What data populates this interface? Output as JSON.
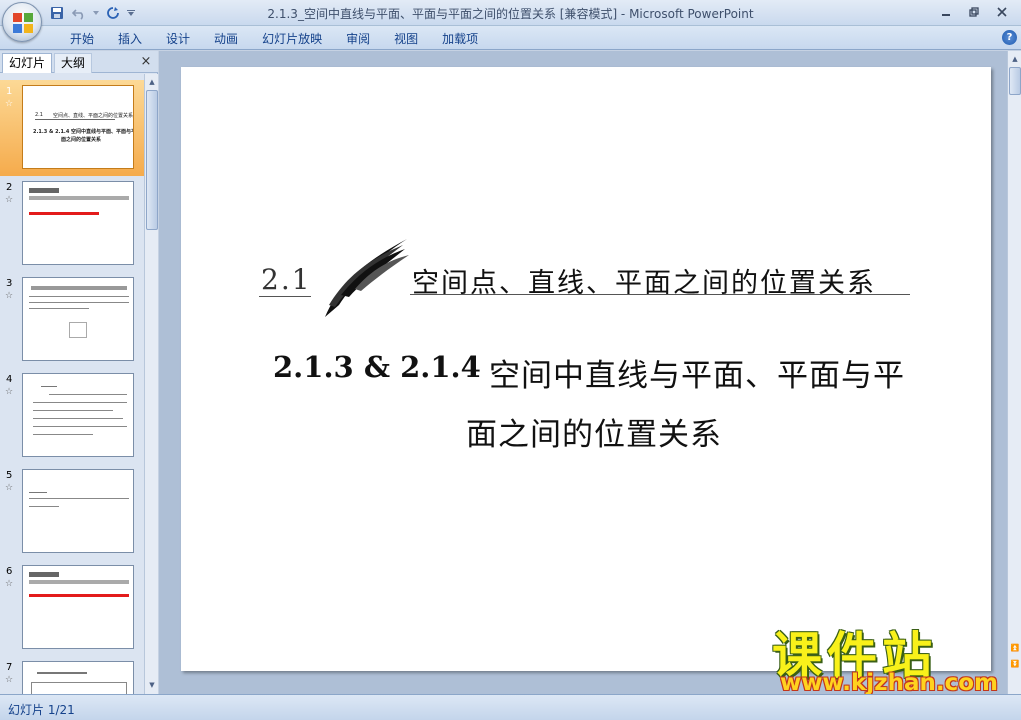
{
  "window": {
    "title": "2.1.3_空间中直线与平面、平面与平面之间的位置关系 [兼容模式] - Microsoft PowerPoint"
  },
  "quick_access": {
    "save_icon": "save-icon",
    "undo_icon": "undo-icon",
    "redo_icon": "redo-icon",
    "customize_icon": "dropdown-icon"
  },
  "window_controls": [
    "minimize-icon",
    "restore-icon",
    "close-icon"
  ],
  "menu_tabs": [
    "开始",
    "插入",
    "设计",
    "动画",
    "幻灯片放映",
    "审阅",
    "视图",
    "加载项"
  ],
  "panel": {
    "tab_slides": "幻灯片",
    "tab_outline": "大纲",
    "close": "×"
  },
  "thumbnails": [
    {
      "num": "1",
      "star": "☆",
      "selected": true
    },
    {
      "num": "2",
      "star": "☆"
    },
    {
      "num": "3",
      "star": "☆"
    },
    {
      "num": "4",
      "star": "☆"
    },
    {
      "num": "5",
      "star": "☆"
    },
    {
      "num": "6",
      "star": "☆"
    },
    {
      "num": "7",
      "star": "☆"
    }
  ],
  "slide": {
    "section_num": "2.1",
    "chapter_title": "空间点、直线、平面之间的位置关系",
    "subtitle_num": "2.1.3 & 2.1.4",
    "subtitle_line1": "空间中直线与平面、平面与平",
    "subtitle_line2": "面之间的位置关系"
  },
  "watermark": {
    "title": "课件站",
    "url": "www.kjzhan.com"
  },
  "status": {
    "slide_counter": "幻灯片 1/21"
  },
  "colors": {
    "ribbon_text": "#15428b",
    "selected_thumb": "#f5ab4c",
    "watermark_yellow": "#f9f11a"
  }
}
